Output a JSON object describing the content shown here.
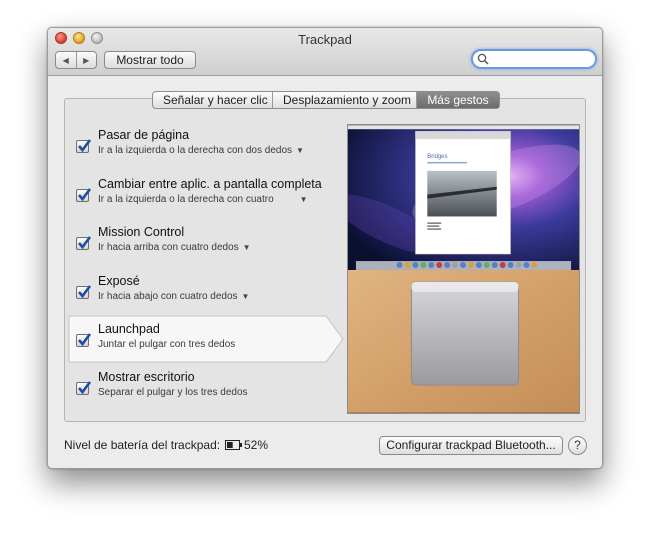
{
  "window": {
    "title": "Trackpad"
  },
  "toolbar": {
    "back": "◀",
    "forward": "▶",
    "show_all_label": "Mostrar todo",
    "search_value": ""
  },
  "tabs": [
    {
      "label": "Señalar y hacer clic",
      "active": false
    },
    {
      "label": "Desplazamiento y zoom",
      "active": false
    },
    {
      "label": "Más gestos",
      "active": true
    }
  ],
  "gestures": [
    {
      "title": "Pasar de página",
      "subtitle": "Ir a la izquierda  o la derecha con dos dedos",
      "checked": true,
      "has_menu": true,
      "selected": false
    },
    {
      "title": "Cambiar entre aplic. a pantalla completa",
      "subtitle": "Ir a la izquierda o la derecha con cuatro",
      "checked": true,
      "has_menu": true,
      "selected": false
    },
    {
      "title": "Mission Control",
      "subtitle": "Ir hacia arriba con cuatro dedos",
      "checked": true,
      "has_menu": true,
      "selected": false
    },
    {
      "title": "Exposé",
      "subtitle": "Ir hacia abajo con cuatro dedos",
      "checked": true,
      "has_menu": true,
      "selected": false
    },
    {
      "title": "Launchpad",
      "subtitle": "Juntar el pulgar con tres dedos",
      "checked": true,
      "has_menu": false,
      "selected": true
    },
    {
      "title": "Mostrar escritorio",
      "subtitle": "Separar el pulgar y los tres dedos",
      "checked": true,
      "has_menu": false,
      "selected": false
    }
  ],
  "preview": {
    "document_title": "Bridges"
  },
  "footer": {
    "battery_label": "Nivel de batería del trackpad:",
    "battery_value": "52%",
    "battery_level": 0.52,
    "bluetooth_button_label": "Configurar trackpad Bluetooth...",
    "help_label": "?"
  },
  "colors": {
    "accent": "#2a6fd6",
    "tab_active": "#7a7a7a",
    "checkbox_check": "#1d4f9e"
  }
}
